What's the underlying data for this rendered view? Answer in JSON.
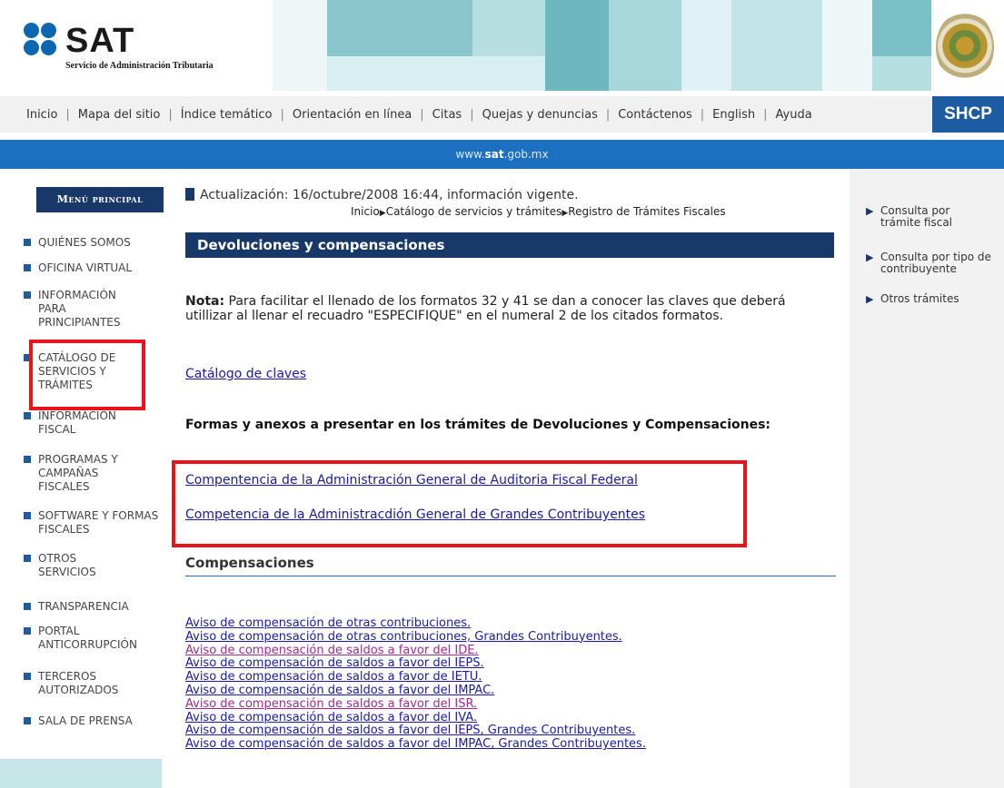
{
  "header": {
    "logo_text": "SAT",
    "logo_subtitle": "Servicio de Administración Tributaria",
    "brand_color": "#1d5ca3",
    "seal_text": "ESTADOS UNIDOS MEXICANOS"
  },
  "top_nav": {
    "items": [
      "Inicio",
      "Mapa del sitio",
      "Índice temático",
      "Orientación en línea",
      "Citas",
      "Quejas y denuncias",
      "Contáctenos",
      "English",
      "Ayuda"
    ],
    "brand_label": "SHCP"
  },
  "url_bar": {
    "prefix": "www.",
    "bold": "sat",
    "suffix": ".gob.mx"
  },
  "sidebar": {
    "heading": "Menú principal",
    "items": [
      "QUIÉNES SOMOS",
      "OFICINA VIRTUAL",
      "INFORMACIÓN PARA PRINCIPIANTES",
      "CATÁLOGO DE SERVICIOS Y TRÁMITES",
      "INFORMACIÓN FISCAL",
      "PROGRAMAS Y CAMPAÑAS FISCALES",
      "SOFTWARE Y FORMAS FISCALES",
      "OTROS SERVICIOS",
      "TRANSPARENCIA",
      "PORTAL ANTICORRUPCIÓN",
      "TERCEROS AUTORIZADOS",
      "SALA DE PRENSA"
    ]
  },
  "main": {
    "update_text": "Actualización: 16/octubre/2008 16:44, información vigente.",
    "breadcrumb": [
      "Inicio",
      "Catálogo de servicios y trámites",
      "Registro de Trámites Fiscales"
    ],
    "section_title": "Devoluciones y compensaciones",
    "nota_label": "Nota:",
    "nota_text": " Para facilitar el llenado de los formatos 32 y 41 se dan a conocer las claves que deberá utillizar al llenar el recuadro \"ESPECIFIQUE\" en el numeral 2 de los citados formatos.",
    "catalog_link": "Catálogo de claves",
    "formas_title": "Formas y anexos a presentar en los trámites de Devoluciones y Compensaciones:",
    "link_agaff": "Compentencia de la  Administración General de Auditoria Fiscal Federal",
    "link_agac": "Competencia de la Administracdión General de Grandes Contribuyentes",
    "compensaciones_title": "Compensaciones",
    "compensaciones_links": [
      "Aviso de compensación de otras contribuciones.",
      "Aviso de compensación de otras contribuciones, Grandes Contribuyentes.",
      "Aviso de compensación de saldos a favor del IDE.",
      "Aviso de compensación de saldos a favor del IEPS.",
      "Aviso de compensación de saldos a favor de IETU.",
      "Aviso de compensación de saldos a favor del IMPAC.",
      "Aviso de compensación de saldos a favor del ISR.",
      "Aviso de compensación de saldos a favor del IVA.",
      "Aviso de compensación de saldos a favor del IEPS, Grandes Contribuyentes.",
      "Aviso de compensación de saldos a favor del IMPAC, Grandes Contribuyentes."
    ]
  },
  "right_nav": {
    "items": [
      "Consulta por trámite fiscal",
      "Consulta por tipo de contribuyente",
      "Otros trámites"
    ]
  },
  "colors": {
    "nav_dark_blue": "#19386a",
    "url_bar_blue": "#1d6fbf",
    "link_blue": "#1a1aa6",
    "visited_link": "#a12b8f",
    "highlight_red": "#e8141c"
  }
}
